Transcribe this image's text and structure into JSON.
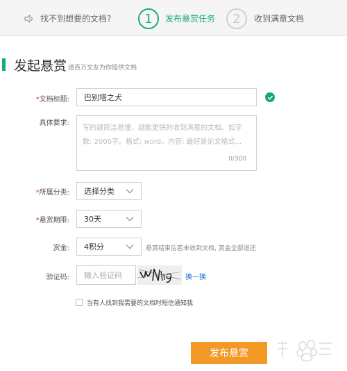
{
  "steps": {
    "step1_label": "找不到想要的文档?",
    "step2_number": "1",
    "step2_label": "发布悬赏任务",
    "step3_number": "2",
    "step3_label": "收到满意文档"
  },
  "header": {
    "title": "发起悬赏",
    "subtitle": "请百万文友为你提供文档"
  },
  "form": {
    "required_mark": "*",
    "doc_title": {
      "label": "文档标题:",
      "value": "巴别塔之犬"
    },
    "requirements": {
      "label": "具体要求:",
      "placeholder": "写的越简洁易懂，越能更快的收到满意的文档。如字数: 2000字。格式: word。内容: 最好是论文格式...",
      "counter": "0/300"
    },
    "category": {
      "label": "所属分类:",
      "value": "选择分类"
    },
    "deadline": {
      "label": "悬赏期限:",
      "value": "30天"
    },
    "reward": {
      "label": "赏金:",
      "value": "4积分",
      "note": "悬赏结束后若未收到文档, 赏金全部退还"
    },
    "captcha": {
      "label": "验证码:",
      "placeholder": "输入验证码",
      "refresh": "换一换"
    },
    "notify": {
      "label": "当有人找到我需要的文档时短信通知我",
      "checked": false
    },
    "submit_label": "发布悬赏"
  },
  "colors": {
    "accent": "#1aa87a",
    "button": "#f39a26",
    "required": "#e4393c",
    "link": "#1a6fc9"
  }
}
